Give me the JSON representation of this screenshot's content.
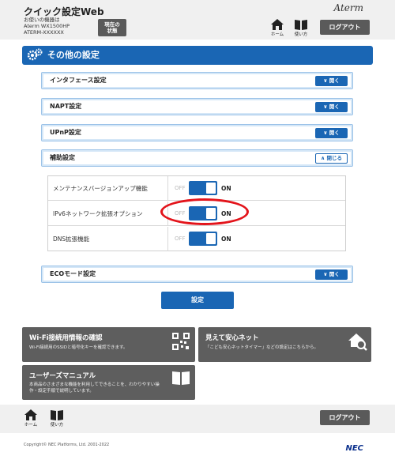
{
  "header": {
    "app_title": "クイック設定Web",
    "device_line1": "お使いの機器は",
    "device_line2": "Aterm WX1500HP",
    "device_line3": "ATERM-XXXXXX",
    "status_label_1": "現在の",
    "status_label_2": "状態",
    "brand": "Aterm",
    "home_label": "ホーム",
    "help_label": "使い方",
    "logout_label": "ログアウト"
  },
  "section": {
    "title": "その他の設定"
  },
  "accordions": {
    "interface": {
      "label": "インタフェース設定",
      "button": "開く"
    },
    "napt": {
      "label": "NAPT設定",
      "button": "開く"
    },
    "upnp": {
      "label": "UPnP設定",
      "button": "開く"
    },
    "aux": {
      "label": "補助設定",
      "button": "閉じる"
    },
    "eco": {
      "label": "ECOモード設定",
      "button": "開く"
    }
  },
  "aux_rows": [
    {
      "label": "メンテナンスバージョンアップ機能",
      "off": "OFF",
      "on": "ON",
      "state": "ON"
    },
    {
      "label": "IPv6ネットワーク拡張オプション",
      "off": "OFF",
      "on": "ON",
      "state": "ON"
    },
    {
      "label": "DNS拡張機能",
      "off": "OFF",
      "on": "ON",
      "state": "ON"
    }
  ],
  "apply_label": "設定",
  "panels": {
    "wifi": {
      "title": "Wi-Fi接続用情報の確認",
      "desc": "Wi-Fi接続用のSSIDと暗号化キーを確認できます。"
    },
    "safe": {
      "title": "見えて安心ネット",
      "desc": "「こども安心ネットタイマー」などの設定はこちらから。"
    },
    "manual": {
      "title": "ユーザーズマニュアル",
      "desc1": "本商品のさまざまな機能を利用してできることを、わかりやすい操",
      "desc2": "作・設定手順で説明しています。"
    }
  },
  "footer": {
    "home_label": "ホーム",
    "help_label": "使い方",
    "logout_label": "ログアウト",
    "copyright": "Copyright© NEC Platforms, Ltd. 2001-2022",
    "nec": "NEC"
  },
  "colors": {
    "accent": "#1a66b4",
    "panel": "#5e5e5e",
    "highlight": "#e3141b"
  }
}
